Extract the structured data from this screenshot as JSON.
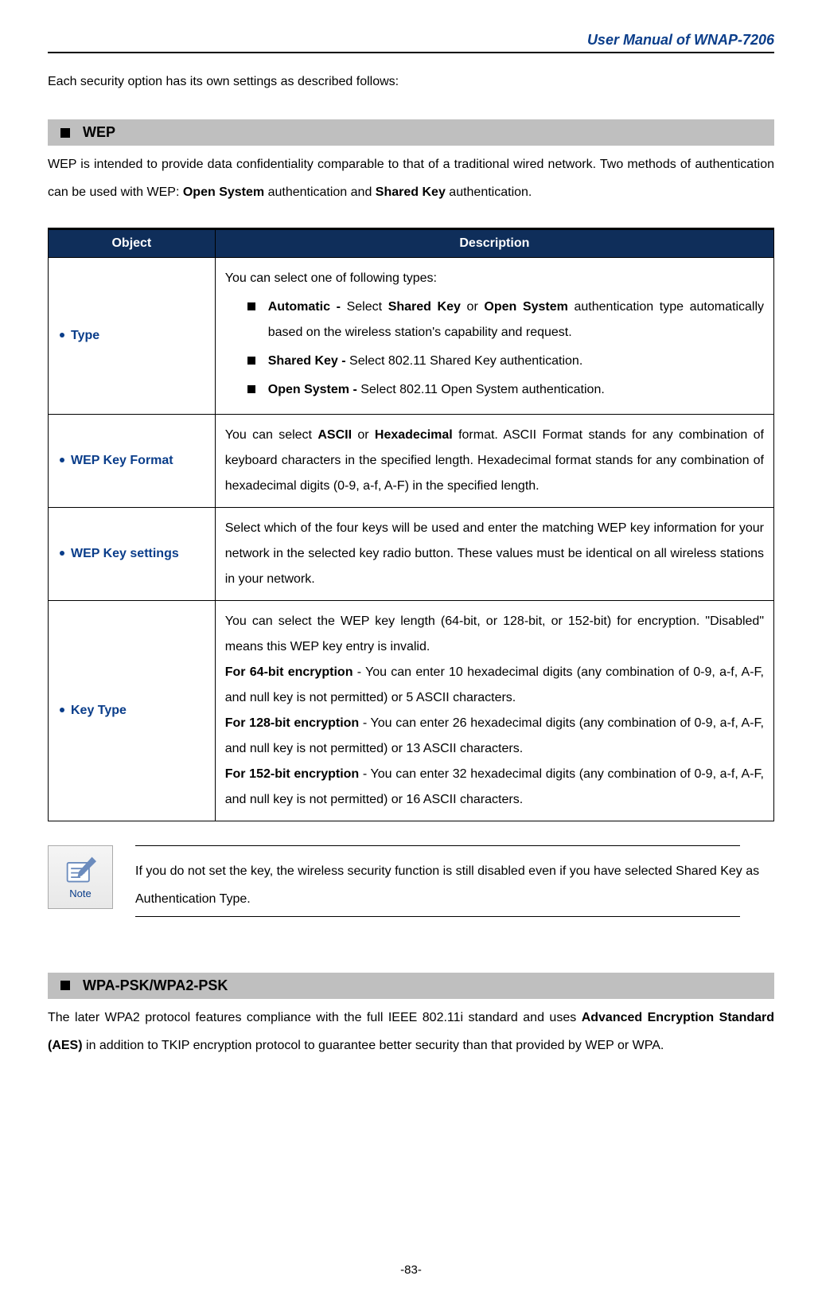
{
  "header": {
    "title": "User Manual of WNAP-7206"
  },
  "intro": "Each security option has its own settings as described follows:",
  "section_wep": {
    "title": "WEP",
    "desc_prefix": "WEP is intended to provide data confidentiality comparable to that of a traditional wired network. Two methods of authentication can be used with WEP: ",
    "bold1": "Open System",
    "mid1": " authentication and ",
    "bold2": "Shared Key",
    "suffix": " authentication."
  },
  "table": {
    "head_object": "Object",
    "head_description": "Description",
    "rows": [
      {
        "object": "Type",
        "desc_lead": "You can select one of following types:",
        "bullets": [
          {
            "bold": "Automatic - ",
            "after_bold": "Select ",
            "b2": "Shared Key",
            "mid": " or ",
            "b3": "Open System",
            "tail": " authentication type automatically based on the wireless station's capability and request."
          },
          {
            "bold": "Shared Key - ",
            "tail": "  Select 802.11 Shared Key authentication."
          },
          {
            "bold": "Open System - ",
            "tail": "Select 802.11 Open System authentication."
          }
        ]
      },
      {
        "object": "WEP Key Format",
        "plain_parts": [
          "You can select ",
          " or ",
          " format. ASCII Format stands for any combination of keyboard characters in the specified length. Hexadecimal format stands for any combination of hexadecimal digits (0-9, a-f, A-F) in the specified length."
        ],
        "bold_parts": [
          "ASCII",
          "Hexadecimal"
        ]
      },
      {
        "object": "WEP Key settings",
        "plain": "Select which of the four keys will be used and enter the matching WEP key information for your network in the selected key radio button. These values must be identical on all wireless stations in your network."
      },
      {
        "object": "Key Type",
        "lead": "You can select the WEP key length (64-bit, or 128-bit, or 152-bit) for encryption. \"Disabled\" means this WEP key entry is invalid.",
        "enc": [
          {
            "b": "For 64-bit encryption",
            "t": " - You can enter 10 hexadecimal digits (any combination of 0-9, a-f, A-F, and null key is not permitted) or 5 ASCII characters."
          },
          {
            "b": "For 128-bit encryption",
            "t": " - You can enter 26 hexadecimal digits (any combination of 0-9, a-f, A-F, and null key is not permitted) or 13 ASCII characters."
          },
          {
            "b": "For 152-bit encryption",
            "t": " - You can enter 32 hexadecimal digits (any combination of 0-9, a-f, A-F, and null key is not permitted) or 16 ASCII characters."
          }
        ]
      }
    ]
  },
  "note": {
    "label": "Note",
    "text": "If you do not set the key, the wireless security function is still disabled even if you have selected Shared Key as Authentication Type."
  },
  "section_wpa": {
    "title": "WPA-PSK/WPA2-PSK",
    "pre": "The later WPA2 protocol features compliance with the full IEEE 802.11i standard and uses ",
    "bold": "Advanced Encryption Standard (AES)",
    "post": " in addition to TKIP encryption protocol to guarantee better security than that provided by WEP or WPA."
  },
  "footer": "-83-"
}
